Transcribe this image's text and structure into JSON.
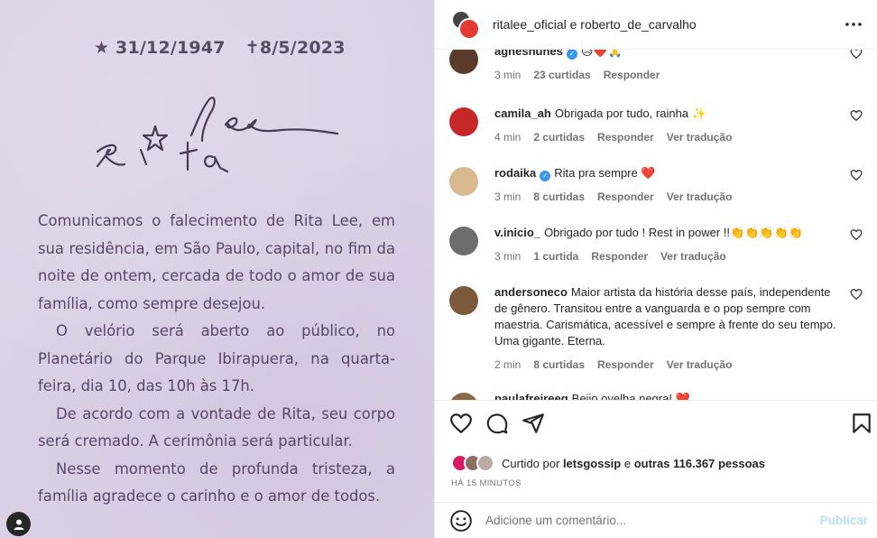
{
  "post": {
    "dates": {
      "birth": "★ 31/12/1947",
      "death": "✝8/5/2023"
    },
    "signature_text": "Rita Lee",
    "paragraphs": [
      "Comunicamos o falecimento de Rita Lee, em sua residência, em São Paulo, capital, no fim da noite de ontem, cercada de todo o amor de sua família, como sempre desejou.",
      "O velório será aberto ao público, no Planetário do Parque Ibirapuera, na quarta-feira, dia 10, das 10h às 17h.",
      "De acordo com a vontade de Rita, seu corpo será cremado. A cerimônia será particular.",
      "Nesse momento de profunda tristeza, a família agradece o carinho e o amor de todos."
    ],
    "background_color": "#dcd0e6",
    "text_color": "#5b4668"
  },
  "header": {
    "title": "ritalee_oficial e roberto_de_carvalho",
    "more_icon": "more-horizontal-icon"
  },
  "comments": [
    {
      "user": "agnesnunes",
      "verified": true,
      "text": "😥❤️🙏",
      "time": "3 min",
      "likes": "23 curtidas",
      "reply": "Responder",
      "translate": "",
      "avatar_color": "#5b3b2a"
    },
    {
      "user": "camila_ah",
      "verified": false,
      "text": "Obrigada por tudo, rainha ✨",
      "time": "4 min",
      "likes": "2 curtidas",
      "reply": "Responder",
      "translate": "Ver tradução",
      "avatar_color": "#c62828"
    },
    {
      "user": "rodaika",
      "verified": true,
      "text": "Rita pra sempre ❤️",
      "time": "3 min",
      "likes": "8 curtidas",
      "reply": "Responder",
      "translate": "Ver tradução",
      "avatar_color": "#d9b98f"
    },
    {
      "user": "v.inicio_",
      "verified": false,
      "text": "Obrigado por tudo ! Rest in power !!👏👏👏👏👏",
      "time": "3 min",
      "likes": "1 curtida",
      "reply": "Responder",
      "translate": "Ver tradução",
      "avatar_color": "#6d6d6d"
    },
    {
      "user": "andersoneco",
      "verified": false,
      "text": "Maior artista da história desse país, independente de gênero. Transitou entre a vanguarda e o pop sempre com maestria. Carismática, acessível e sempre à frente do seu tempo. Uma gigante. Eterna.",
      "time": "2 min",
      "likes": "8 curtidas",
      "reply": "Responder",
      "translate": "Ver tradução",
      "avatar_color": "#7a5a3a"
    },
    {
      "user": "paulafreireeg",
      "verified": false,
      "text": "Beijo ovelha negra! ❤️",
      "time": "",
      "likes": "",
      "reply": "",
      "translate": "",
      "avatar_color": "#8a6a4a"
    }
  ],
  "likes": {
    "prefix": "Curtido por",
    "user": "letsgossip",
    "connector": "e",
    "others": "outras 116.367 pessoas",
    "avatar_colors": [
      "#d81b60",
      "#8d6e63",
      "#bcaaa4"
    ]
  },
  "time_ago": "HÁ 15 MINUTOS",
  "add_comment": {
    "placeholder": "Adicione um comentário...",
    "publish_label": "Publicar",
    "publish_color": "#b2dffc"
  }
}
